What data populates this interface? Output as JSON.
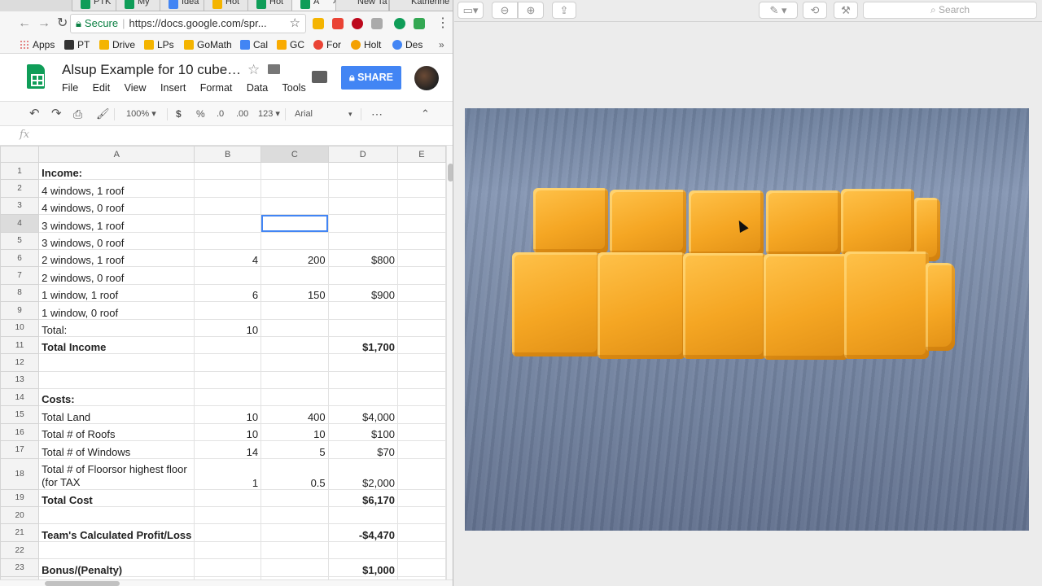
{
  "browser": {
    "tabs": [
      {
        "label": "PTK",
        "icon": "green-doc-icon"
      },
      {
        "label": "My",
        "icon": "sheets-icon"
      },
      {
        "label": "Idea",
        "icon": "docs-icon"
      },
      {
        "label": "Hot",
        "icon": "yellow-icon"
      },
      {
        "label": "Hot",
        "icon": "sheets-icon"
      },
      {
        "label": "A",
        "icon": "sheets-icon"
      },
      {
        "label": "New Ta",
        "icon": ""
      },
      {
        "label": "Katherine",
        "icon": ""
      }
    ],
    "secure_label": "Secure",
    "url": "https://docs.google.com/spr...",
    "bookmarks": [
      {
        "label": "Apps",
        "icon": "apps-grid-icon"
      },
      {
        "label": "PT",
        "icon": "pt-icon"
      },
      {
        "label": "Drive",
        "icon": "drive-icon"
      },
      {
        "label": "LPs",
        "icon": "drive-icon"
      },
      {
        "label": "GoMath",
        "icon": "drive-icon"
      },
      {
        "label": "Cal",
        "icon": "calendar-icon"
      },
      {
        "label": "GC",
        "icon": "classroom-icon"
      },
      {
        "label": "For",
        "icon": "forms-icon"
      },
      {
        "label": "Holt",
        "icon": "holt-icon"
      },
      {
        "label": "Des",
        "icon": "desmos-icon"
      }
    ],
    "more_label": "»"
  },
  "sheets": {
    "title": "Alsup Example for 10 cube…",
    "menu": [
      "File",
      "Edit",
      "View",
      "Insert",
      "Format",
      "Data",
      "Tools"
    ],
    "share_label": "SHARE",
    "toolbar": {
      "zoom": "100%",
      "currency": "$",
      "percent": "%",
      "decrease_decimal": ".0",
      "increase_decimal": ".00",
      "number_format": "123",
      "font": "Arial",
      "more": "⋯"
    },
    "fx": "fx",
    "columns": [
      "A",
      "B",
      "C",
      "D",
      "E"
    ],
    "rows": [
      {
        "n": "1",
        "a": "Income:",
        "b": "",
        "c": "",
        "d": "",
        "bold": true
      },
      {
        "n": "2",
        "a": "4 windows, 1 roof",
        "b": "",
        "c": "",
        "d": ""
      },
      {
        "n": "3",
        "a": "4 windows, 0 roof",
        "b": "",
        "c": "",
        "d": ""
      },
      {
        "n": "4",
        "a": "3 windows, 1 roof",
        "b": "",
        "c": "",
        "d": ""
      },
      {
        "n": "5",
        "a": "3 windows, 0 roof",
        "b": "",
        "c": "",
        "d": ""
      },
      {
        "n": "6",
        "a": "2 windows, 1 roof",
        "b": "4",
        "c": "200",
        "d": "$800"
      },
      {
        "n": "7",
        "a": "2 windows, 0 roof",
        "b": "",
        "c": "",
        "d": ""
      },
      {
        "n": "8",
        "a": "1 window, 1 roof",
        "b": "6",
        "c": "150",
        "d": "$900"
      },
      {
        "n": "9",
        "a": "1 window, 0 roof",
        "b": "",
        "c": "",
        "d": ""
      },
      {
        "n": "10",
        "a": "Total:",
        "b": "10",
        "c": "",
        "d": ""
      },
      {
        "n": "11",
        "a": "Total Income",
        "b": "",
        "c": "",
        "d": "$1,700",
        "bold": true
      },
      {
        "n": "12",
        "a": "",
        "b": "",
        "c": "",
        "d": ""
      },
      {
        "n": "13",
        "a": "",
        "b": "",
        "c": "",
        "d": ""
      },
      {
        "n": "14",
        "a": "Costs:",
        "b": "",
        "c": "",
        "d": "",
        "bold": true
      },
      {
        "n": "15",
        "a": "Total Land",
        "b": "10",
        "c": "400",
        "d": "$4,000"
      },
      {
        "n": "16",
        "a": "Total # of Roofs",
        "b": "10",
        "c": "10",
        "d": "$100"
      },
      {
        "n": "17",
        "a": "Total # of Windows",
        "b": "14",
        "c": "5",
        "d": "$70"
      },
      {
        "n": "18",
        "a": "Total # of Floorsor highest floor (for TAX",
        "b": "1",
        "c": "0.5",
        "d": "$2,000",
        "tall": true
      },
      {
        "n": "19",
        "a": "Total Cost",
        "b": "",
        "c": "",
        "d": "$6,170",
        "bold": true
      },
      {
        "n": "20",
        "a": "",
        "b": "",
        "c": "",
        "d": ""
      },
      {
        "n": "21",
        "a": "Team's Calculated Profit/Loss",
        "b": "",
        "c": "",
        "d": "-$4,470",
        "bold": true
      },
      {
        "n": "22",
        "a": "",
        "b": "",
        "c": "",
        "d": ""
      },
      {
        "n": "23",
        "a": "Bonus/(Penalty)",
        "b": "",
        "c": "",
        "d": "$1,000",
        "bold": true
      },
      {
        "n": "24",
        "a": "",
        "b": "",
        "c": "",
        "d": ""
      }
    ],
    "selected_cell": "C4"
  },
  "preview": {
    "search_placeholder": "Search"
  }
}
